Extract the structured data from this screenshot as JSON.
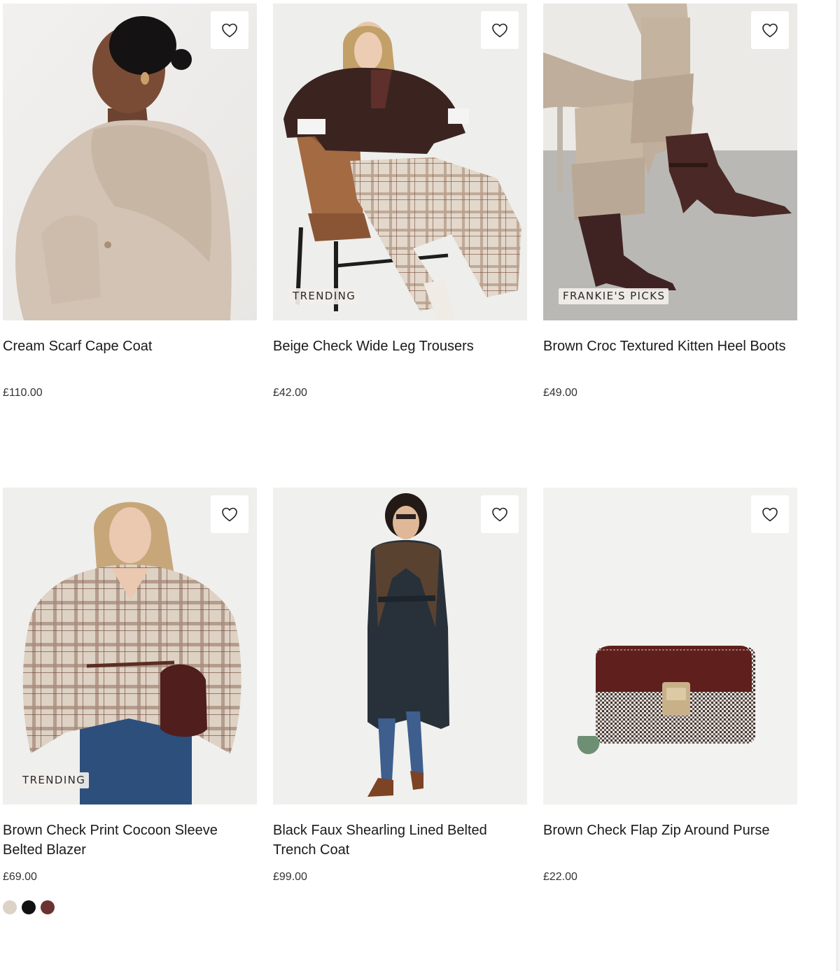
{
  "products": [
    {
      "title": "Cream Scarf Cape Coat",
      "price": "£110.00",
      "badge": "",
      "wishlist_icon": "heart-outline-icon"
    },
    {
      "title": "Beige Check Wide Leg Trousers",
      "price": "£42.00",
      "badge": "TRENDING",
      "wishlist_icon": "heart-outline-icon"
    },
    {
      "title": "Brown Croc Textured Kitten Heel Boots",
      "price": "£49.00",
      "badge": "FRANKIE'S PICKS",
      "wishlist_icon": "heart-outline-icon"
    },
    {
      "title": "Brown Check Print Cocoon Sleeve Belted Blazer",
      "price": "£69.00",
      "badge": "TRENDING",
      "wishlist_icon": "heart-outline-icon",
      "swatches": [
        "#dcd2c6",
        "#111111",
        "#6a3331"
      ]
    },
    {
      "title": "Black Faux Shearling Lined Belted Trench Coat",
      "price": "£99.00",
      "badge": "",
      "wishlist_icon": "heart-outline-icon"
    },
    {
      "title": "Brown Check Flap Zip Around Purse",
      "price": "£22.00",
      "badge": "",
      "wishlist_icon": "heart-outline-icon"
    }
  ]
}
